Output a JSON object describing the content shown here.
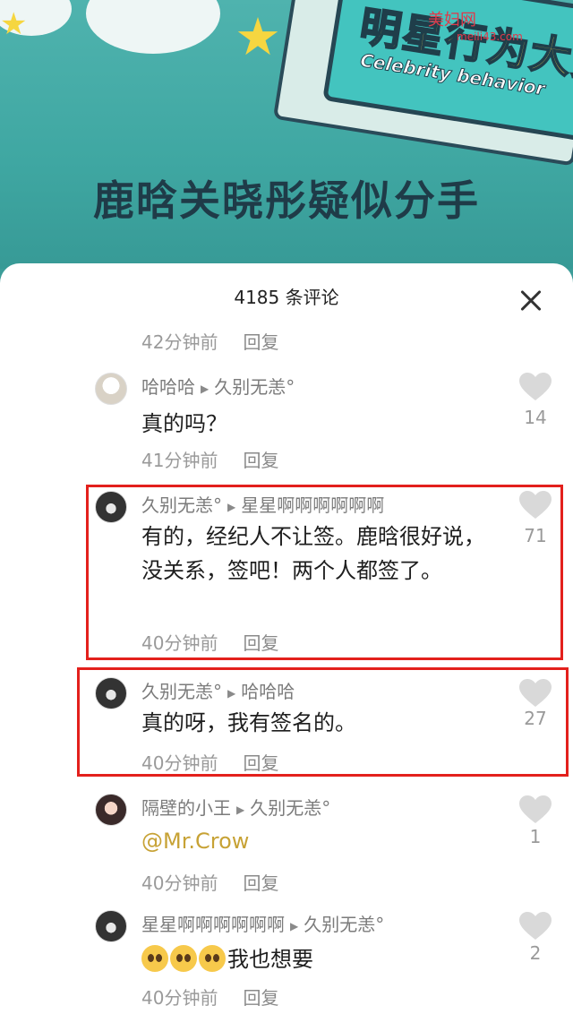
{
  "banner": {
    "ticket_title": "明星行为大赏",
    "ticket_subtitle": "Celebrity behavior",
    "watermark": "美妇网",
    "watermark_url": "meili43.com",
    "headline": "鹿晗关晓彤疑似分手"
  },
  "panel": {
    "title": "4185 条评论",
    "close_label": "×"
  },
  "top_meta": {
    "time": "42分钟前",
    "reply": "回复"
  },
  "comments": [
    {
      "author": "哈哈哈",
      "reply_to": "久别无恙°",
      "text": "真的吗？",
      "mention": "",
      "time": "41分钟前",
      "reply": "回复",
      "likes": "14"
    },
    {
      "author": "久别无恙°",
      "reply_to": "星星啊啊啊啊啊啊",
      "text": "有的，经纪人不让签。鹿晗很好说，没关系，签吧！两个人都签了。",
      "mention": "",
      "time": "40分钟前",
      "reply": "回复",
      "likes": "71"
    },
    {
      "author": "久别无恙°",
      "reply_to": "哈哈哈",
      "text": "真的呀，我有签名的。",
      "mention": "",
      "time": "40分钟前",
      "reply": "回复",
      "likes": "27"
    },
    {
      "author": "隔壁的小王",
      "reply_to": "久别无恙°",
      "text": "",
      "mention": "@Mr.Crow",
      "time": "40分钟前",
      "reply": "回复",
      "likes": "1"
    },
    {
      "author": "星星啊啊啊啊啊啊",
      "reply_to": "久别无恙°",
      "text": "我也想要",
      "mention": "",
      "time": "40分钟前",
      "reply": "回复",
      "likes": "2"
    }
  ],
  "icons": {
    "heart": "heart-icon",
    "arrow": "triangle-right-icon",
    "close": "close-icon",
    "emoji": "pleading-face-emoji"
  },
  "colors": {
    "banner": "#3fa7a2",
    "highlight": "#e3201c",
    "mention": "#c7a235"
  }
}
